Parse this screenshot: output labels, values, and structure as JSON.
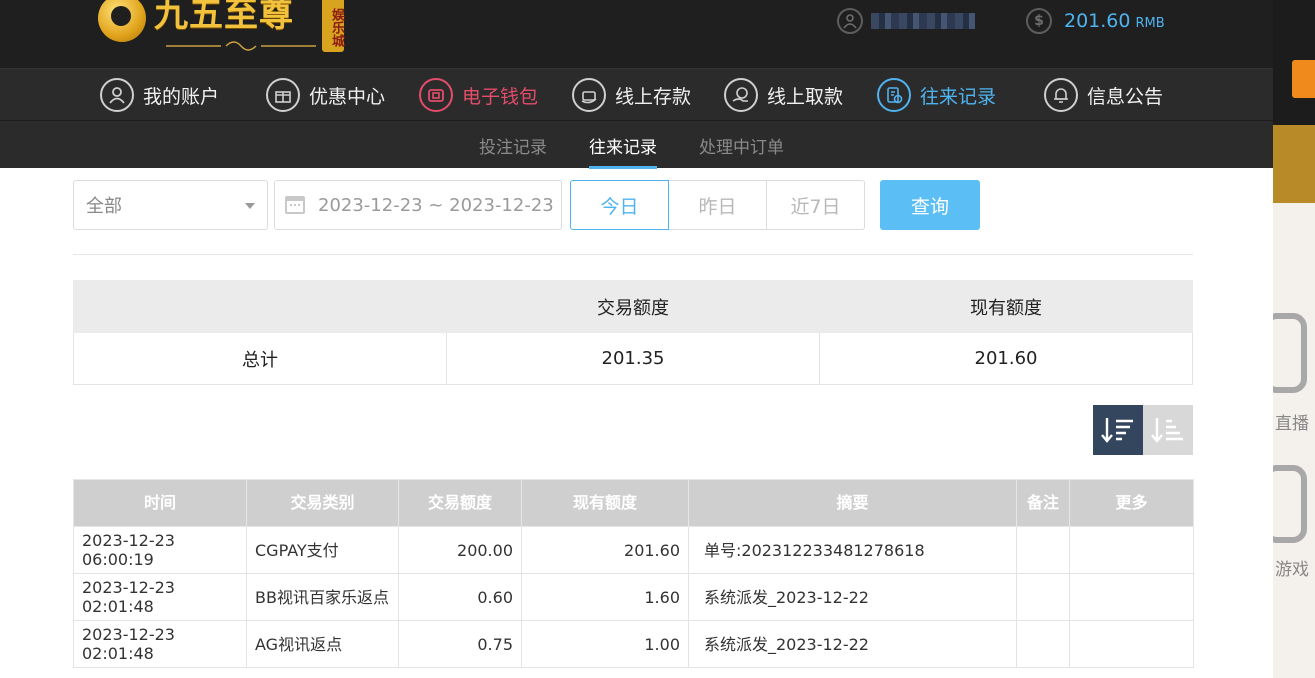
{
  "header": {
    "logo_text": "九五至尊",
    "logo_badge": "娱乐城",
    "balance": "201.60",
    "currency": "RMB"
  },
  "nav": {
    "items": [
      {
        "label": "我的账户",
        "icon": "user-icon"
      },
      {
        "label": "优惠中心",
        "icon": "gift-icon"
      },
      {
        "label": "电子钱包",
        "icon": "wallet-icon"
      },
      {
        "label": "线上存款",
        "icon": "deposit-icon"
      },
      {
        "label": "线上取款",
        "icon": "withdraw-icon"
      },
      {
        "label": "往来记录",
        "icon": "records-icon"
      },
      {
        "label": "信息公告",
        "icon": "bell-icon"
      }
    ],
    "active": "往来记录"
  },
  "subnav": {
    "tabs": [
      {
        "label": "投注记录"
      },
      {
        "label": "往来记录"
      },
      {
        "label": "处理中订单"
      }
    ],
    "active": "往来记录"
  },
  "filters": {
    "type_value": "全部",
    "date_range": "2023-12-23 ~ 2023-12-23",
    "quick": [
      "今日",
      "昨日",
      "近7日"
    ],
    "quick_active": "今日",
    "query_label": "查询"
  },
  "summary": {
    "headers": [
      "",
      "交易额度",
      "现有额度"
    ],
    "row": [
      "总计",
      "201.35",
      "201.60"
    ]
  },
  "records": {
    "headers": [
      "时间",
      "交易类别",
      "交易额度",
      "现有额度",
      "摘要",
      "备注",
      "更多"
    ],
    "rows": [
      [
        "2023-12-23 06:00:19",
        "CGPAY支付",
        "200.00",
        "201.60",
        "单号:202312233481278618",
        "",
        ""
      ],
      [
        "2023-12-23 02:01:48",
        "BB视讯百家乐返点",
        "0.60",
        "1.60",
        "系统派发_2023-12-22",
        "",
        ""
      ],
      [
        "2023-12-23 02:01:48",
        "AG视讯返点",
        "0.75",
        "1.00",
        "系统派发_2023-12-22",
        "",
        ""
      ]
    ]
  },
  "side": {
    "label1": "直播",
    "label2": "游戏"
  },
  "colors": {
    "accent": "#4fb3f0",
    "wallet": "#e44d6a",
    "query_button": "#5bbef5",
    "topbar": "#1f1f1f",
    "nav": "#2b2b2b"
  }
}
